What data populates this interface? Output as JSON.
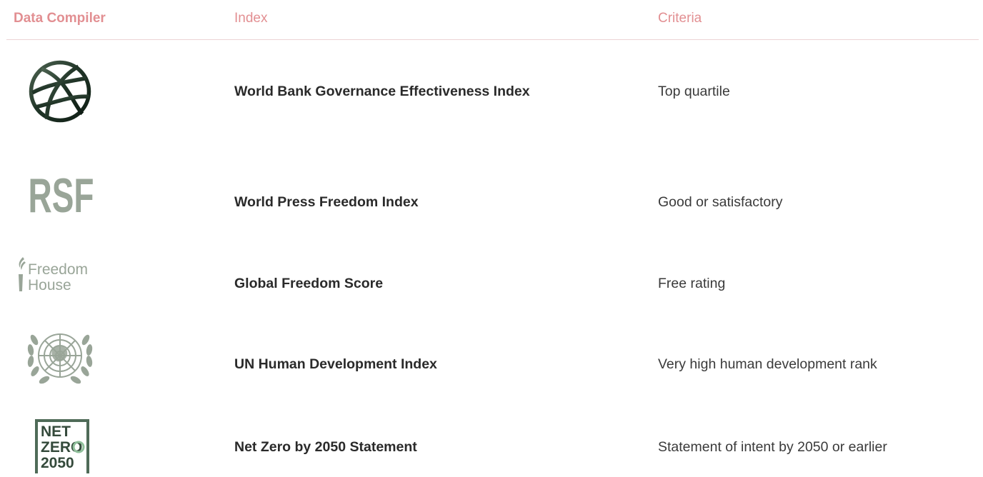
{
  "headers": {
    "compiler": "Data Compiler",
    "index": "Index",
    "criteria": "Criteria"
  },
  "accent_color": "#e28f92",
  "logo_color": "#99a598",
  "rows": [
    {
      "logo": "world-bank-globe-icon",
      "index": "World Bank Governance Effectiveness Index",
      "criteria": "Top quartile"
    },
    {
      "logo": "rsf-logo",
      "logo_text": "RSF",
      "index": "World Press Freedom Index",
      "criteria": "Good or satisfactory"
    },
    {
      "logo": "freedom-house-logo",
      "logo_text_line1": "Freedom",
      "logo_text_line2": "House",
      "index": "Global Freedom Score",
      "criteria": "Free rating"
    },
    {
      "logo": "un-emblem-icon",
      "index": "UN Human Development Index",
      "criteria": "Very high human development rank"
    },
    {
      "logo": "net-zero-2050-logo",
      "logo_text_line1": "NET",
      "logo_text_line2": "ZERO",
      "logo_text_line3": "2050",
      "index": "Net Zero by 2050 Statement",
      "criteria": "Statement of intent by 2050 or earlier"
    }
  ]
}
